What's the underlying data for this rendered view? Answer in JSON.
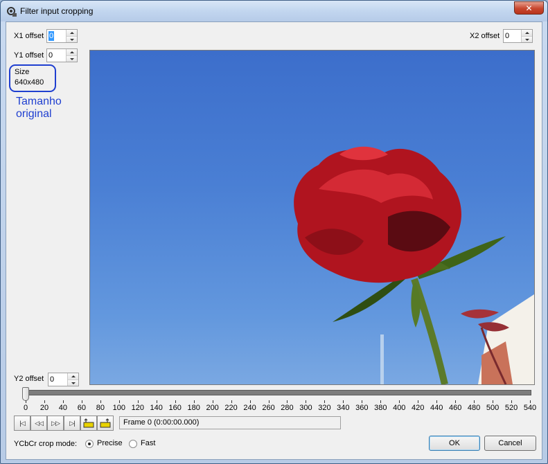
{
  "window": {
    "title": "Filter input cropping",
    "close_glyph": "✕"
  },
  "offsets": {
    "x1_label": "X1 offset",
    "x1_value": "0",
    "y1_label": "Y1 offset",
    "y1_value": "0",
    "x2_label": "X2 offset",
    "x2_value": "0",
    "y2_label": "Y2 offset",
    "y2_value": "0"
  },
  "size": {
    "label": "Size",
    "value": "640x480"
  },
  "annotation": {
    "line1": "Tamanho",
    "line2": "original",
    "color": "#1f3fd0"
  },
  "timeline": {
    "ticks": [
      "0",
      "20",
      "40",
      "60",
      "80",
      "100",
      "120",
      "140",
      "160",
      "180",
      "200",
      "220",
      "240",
      "260",
      "280",
      "300",
      "320",
      "340",
      "360",
      "380",
      "400",
      "420",
      "440",
      "460",
      "480",
      "500",
      "520",
      "540"
    ],
    "position": 0,
    "max": 540,
    "frame_text": "Frame 0 (0:00:00.000)"
  },
  "nav_buttons": [
    {
      "name": "go-start-button",
      "glyph": "|◁"
    },
    {
      "name": "step-back-button",
      "glyph": "◁◁"
    },
    {
      "name": "step-forward-button",
      "glyph": "▷▷"
    },
    {
      "name": "go-end-button",
      "glyph": "▷|"
    },
    {
      "name": "keyframe-prev-button",
      "icon": "key-prev-icon"
    },
    {
      "name": "keyframe-next-button",
      "icon": "key-next-icon"
    }
  ],
  "crop_mode": {
    "label": "YCbCr crop mode:",
    "options": [
      {
        "label": "Precise",
        "selected": true
      },
      {
        "label": "Fast",
        "selected": false
      }
    ]
  },
  "buttons": {
    "ok": "OK",
    "cancel": "Cancel"
  }
}
